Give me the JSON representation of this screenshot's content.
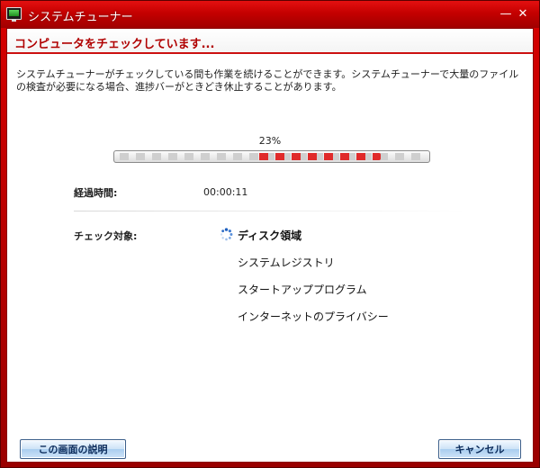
{
  "window": {
    "title": "システムチューナー",
    "minimize_glyph": "—",
    "close_glyph": "✕"
  },
  "header": {
    "title": "コンピュータをチェックしています..."
  },
  "description": {
    "line1": "システムチューナーがチェックしている間も作業を続けることができます。システムチューナーで大量のファイル",
    "line2": "の検査が必要になる場合、進捗バーがときどき休止することがあります。"
  },
  "progress": {
    "percent_text": "23%",
    "value": 0.23
  },
  "elapsed": {
    "label": "経過時間:",
    "value": "00:00:11"
  },
  "targets": {
    "label": "チェック対象:",
    "items": [
      {
        "label": "ディスク領域",
        "active": true
      },
      {
        "label": "システムレジストリ",
        "active": false
      },
      {
        "label": "スタートアッププログラム",
        "active": false
      },
      {
        "label": "インターネットのプライバシー",
        "active": false
      }
    ]
  },
  "buttons": {
    "help_label": "この画面の説明",
    "cancel_label": "キャンセル"
  },
  "colors": {
    "accent": "#c00000",
    "header_text": "#b00000",
    "progress_active": "#e02a2a",
    "button_text": "#0a2a5a"
  },
  "icons": {
    "app": "monitor-icon",
    "busy": "spinner-icon"
  }
}
